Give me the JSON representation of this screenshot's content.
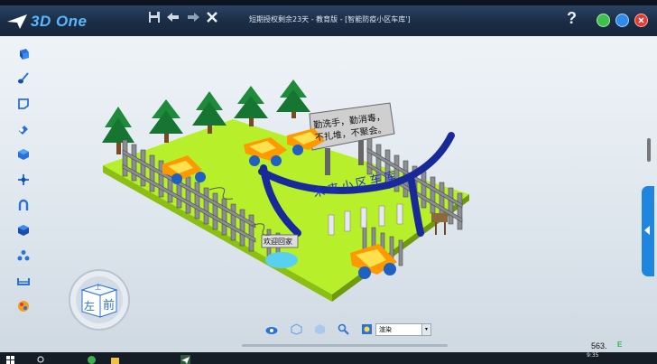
{
  "app": {
    "brand": "3D One",
    "doc_title": "短期授权剩余23天 - 教育版 - [智能防疫小区车库']",
    "help_label": "?"
  },
  "window_controls": [
    {
      "name": "minimize",
      "color": "#3cc24a"
    },
    {
      "name": "restore",
      "color": "#2f8be8"
    },
    {
      "name": "close",
      "color": "#e43a2f"
    }
  ],
  "sidebar_tools": [
    "cube-tool-icon",
    "brush-icon",
    "sketch-icon",
    "edit-shape-icon",
    "special-feature-icon",
    "move-icon",
    "combine-icon",
    "color-icon",
    "pattern-icon",
    "measure-icon",
    "material-icon"
  ],
  "bottom_tools": [
    "eye-icon",
    "view-icon",
    "shaded-icon",
    "zoom-icon",
    "render-icon"
  ],
  "render_mode": "渲染",
  "scene_signs": {
    "board_text": "勤洗手，勤消毒，不扎堆，不聚会。",
    "arch_text": "未来小区车库",
    "welcome_text": "欢迎回家"
  },
  "viewcube": {
    "left": "左",
    "front": "前",
    "top": "上"
  },
  "status": {
    "coord": "563.",
    "eval": "E"
  },
  "taskbar": {
    "clock": "9:35"
  }
}
